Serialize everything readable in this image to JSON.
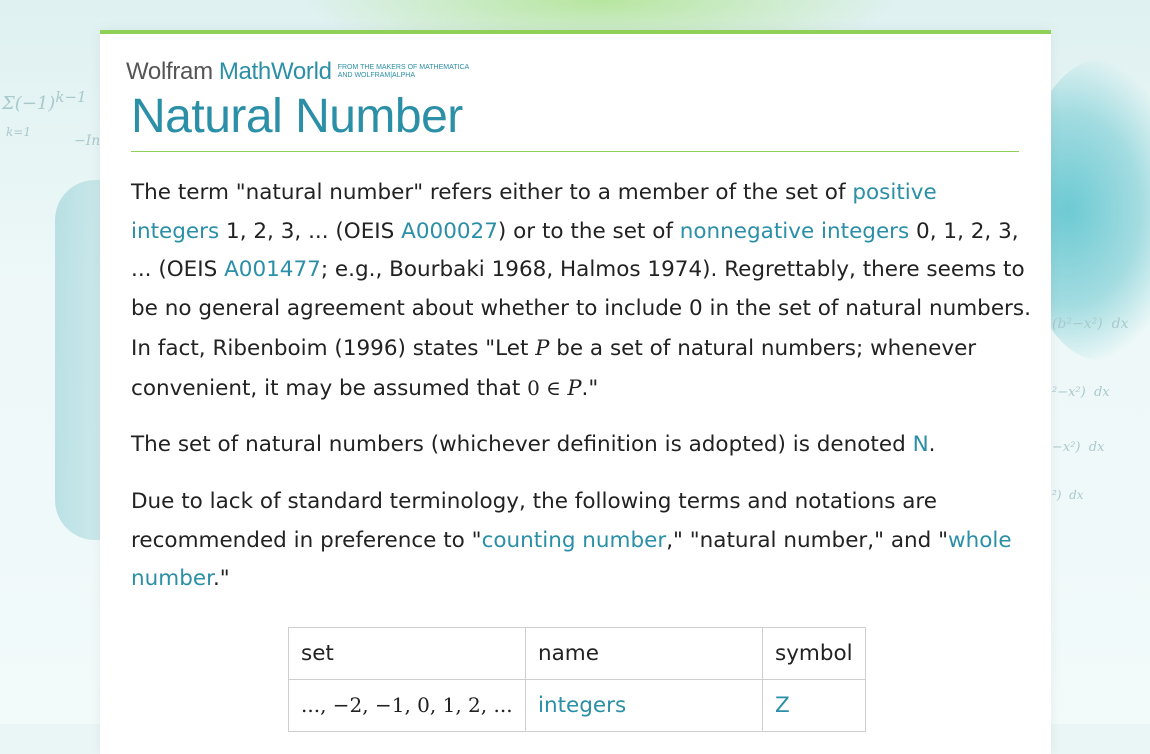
{
  "header": {
    "brand_wolfram": "Wolfram",
    "brand_mathworld": "MathWorld",
    "tagline_line1": "FROM THE MAKERS OF MATHEMATICA",
    "tagline_line2": "AND WOLFRAM|ALPHA"
  },
  "page": {
    "title": "Natural Number"
  },
  "para1": {
    "t1": "The term \"natural number\" refers either to a member of the set of ",
    "link_positive_integers": "positive integers",
    "t2": " 1, 2, 3, ... (OEIS ",
    "link_a000027": "A000027",
    "t3": ") or to the set of ",
    "link_nonnegative_integers": "nonnegative integers",
    "t4": " 0, 1, 2, 3, ... (OEIS ",
    "link_a001477": "A001477",
    "t5": "; e.g., Bourbaki 1968, Halmos 1974). Regrettably, there seems to be no general agreement about whether to include 0 in the set of natural numbers. In fact, Ribenboim (1996) states \"Let ",
    "math_p": "P",
    "t6": " be a set of natural numbers; whenever convenient, it may be assumed that ",
    "math_0": "0",
    "math_in": " ∈ ",
    "math_p2": "P",
    "t7": ".\""
  },
  "para2": {
    "t1": "The set of natural numbers (whichever definition is adopted) is denoted ",
    "link_n": "N",
    "t2": "."
  },
  "para3": {
    "t1": "Due to lack of standard terminology, the following terms and notations are recommended in preference to \"",
    "link_counting_number": "counting number",
    "t2": ",\" \"natural number,\" and \"",
    "link_whole_number": "whole number",
    "t3": ".\""
  },
  "table": {
    "headers": [
      "set",
      "name",
      "symbol"
    ],
    "rows": [
      {
        "set": "..., −2, −1, 0, 1, 2, ...",
        "name": "integers",
        "symbol": "Z"
      }
    ]
  }
}
